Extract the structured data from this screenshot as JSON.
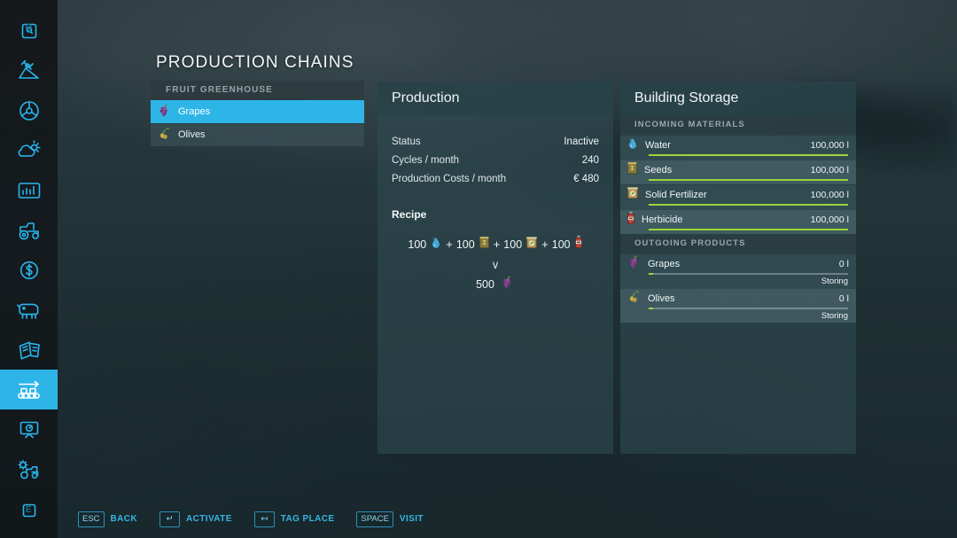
{
  "page_title": "PRODUCTION CHAINS",
  "sidebar": {
    "items": [
      {
        "name": "marker-icon",
        "key_label": "Q",
        "active": false
      },
      {
        "name": "satellite-field-icon",
        "key_label": "",
        "active": false
      },
      {
        "name": "steering-wheel-icon",
        "key_label": "",
        "active": false
      },
      {
        "name": "weather-icon",
        "key_label": "",
        "active": false
      },
      {
        "name": "statistics-icon",
        "key_label": "",
        "active": false
      },
      {
        "name": "tractor-icon",
        "key_label": "",
        "active": false
      },
      {
        "name": "finances-icon",
        "key_label": "",
        "active": false
      },
      {
        "name": "animals-icon",
        "key_label": "",
        "active": false
      },
      {
        "name": "contracts-icon",
        "key_label": "",
        "active": false
      },
      {
        "name": "production-icon",
        "key_label": "",
        "active": true
      },
      {
        "name": "construction-icon",
        "key_label": "",
        "active": false
      },
      {
        "name": "settings-vehicle-icon",
        "key_label": "",
        "active": false
      },
      {
        "name": "key-e-icon",
        "key_label": "E",
        "active": false
      }
    ]
  },
  "chain_list": {
    "group_title": "FRUIT GREENHOUSE",
    "rows": [
      {
        "label": "Grapes",
        "icon": "grapes-icon",
        "selected": true
      },
      {
        "label": "Olives",
        "icon": "olives-icon",
        "selected": false
      }
    ]
  },
  "production": {
    "title": "Production",
    "stats": [
      {
        "label": "Status",
        "value": "Inactive"
      },
      {
        "label": "Cycles / month",
        "value": "240"
      },
      {
        "label": "Production Costs / month",
        "value": "€ 480"
      }
    ],
    "recipe_title": "Recipe",
    "recipe_arrow": "∨",
    "inputs": [
      {
        "amount": "100",
        "icon": "water-drop-icon"
      },
      {
        "amount": "100",
        "icon": "seeds-bag-icon"
      },
      {
        "amount": "100",
        "icon": "solid-fertilizer-icon"
      },
      {
        "amount": "100",
        "icon": "herbicide-bottle-icon"
      }
    ],
    "plus": "+",
    "output": {
      "amount": "500",
      "icon": "grapes-icon"
    }
  },
  "storage": {
    "title": "Building Storage",
    "incoming_header": "INCOMING MATERIALS",
    "incoming": [
      {
        "name": "Water",
        "amount": "100,000 l",
        "fill_pct": 100,
        "icon": "water-drop-icon"
      },
      {
        "name": "Seeds",
        "amount": "100,000 l",
        "fill_pct": 100,
        "icon": "seeds-bag-icon"
      },
      {
        "name": "Solid Fertilizer",
        "amount": "100,000 l",
        "fill_pct": 100,
        "icon": "solid-fertilizer-icon"
      },
      {
        "name": "Herbicide",
        "amount": "100,000 l",
        "fill_pct": 100,
        "icon": "herbicide-bottle-icon"
      }
    ],
    "outgoing_header": "OUTGOING PRODUCTS",
    "outgoing": [
      {
        "name": "Grapes",
        "amount": "0 l",
        "status": "Storing",
        "fill_pct": 2,
        "icon": "grapes-icon"
      },
      {
        "name": "Olives",
        "amount": "0 l",
        "status": "Storing",
        "fill_pct": 2,
        "icon": "olives-icon"
      }
    ]
  },
  "help_bar": [
    {
      "key": "ESC",
      "label": "BACK"
    },
    {
      "key": "↵",
      "label": "ACTIVATE"
    },
    {
      "key": "↤",
      "label": "TAG PLACE"
    },
    {
      "key": "SPACE",
      "label": "VISIT"
    }
  ],
  "colors": {
    "accent": "#2db5e8",
    "bar_fill": "#9ad63d",
    "panel_bg": "#2e4a50",
    "panel_head": "#284248",
    "help_text": "#37b5e4"
  }
}
